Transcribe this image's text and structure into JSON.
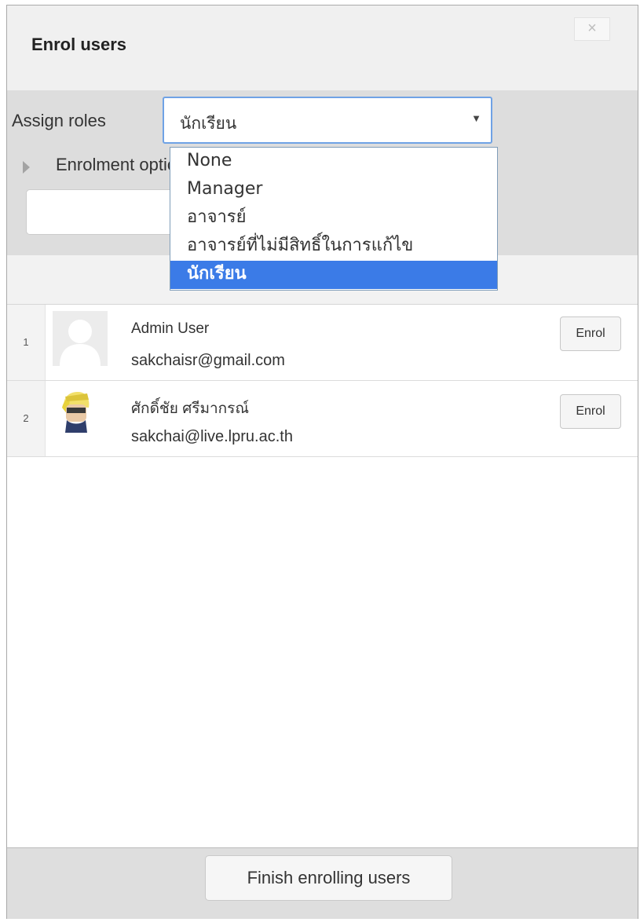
{
  "dialog": {
    "title": "Enrol users",
    "close_label": "×"
  },
  "assign_roles": {
    "label": "Assign roles",
    "selected": "นักเรียน",
    "options": [
      "None",
      "Manager",
      "อาจารย์",
      "อาจารย์ที่ไม่มีสิทธิ์ในการแก้ไข",
      "นักเรียน"
    ]
  },
  "enrolment_options": {
    "label": "Enrolment options"
  },
  "users": [
    {
      "num": "1",
      "name": "Admin User",
      "email": "sakchaisr@gmail.com",
      "button_label": "Enrol"
    },
    {
      "num": "2",
      "name": "ศักดิ์ชัย ศรีมากรณ์",
      "email": "sakchai@live.lpru.ac.th",
      "button_label": "Enrol"
    }
  ],
  "footer": {
    "finish_label": "Finish enrolling users"
  },
  "colors": {
    "accent": "#3b7be7",
    "header_bg": "#f0f0f0",
    "options_bg": "#dddddd"
  }
}
